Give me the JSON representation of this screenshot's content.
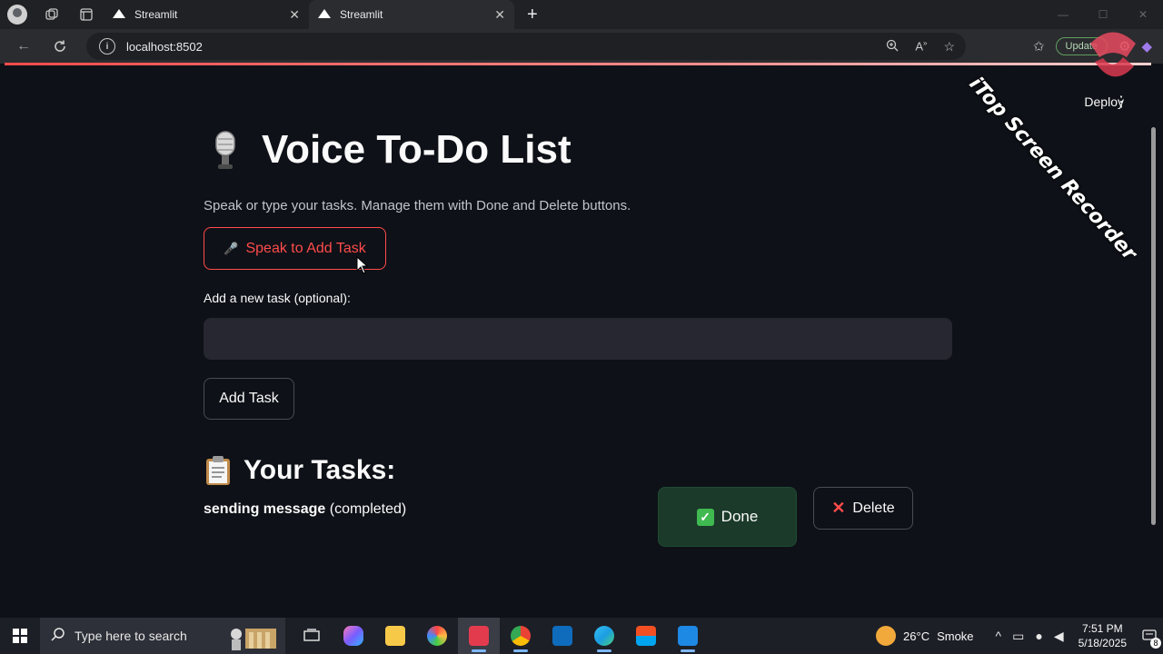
{
  "browser": {
    "tabs": [
      {
        "title": "Streamlit",
        "favicon": "streamlit-icon"
      },
      {
        "title": "Streamlit",
        "favicon": "streamlit-icon",
        "active": true
      }
    ],
    "url": "localhost:8502",
    "update_label": "Update"
  },
  "watermark": {
    "text": "iTop Screen Recorder"
  },
  "header": {
    "deploy_label": "Deploy"
  },
  "app": {
    "title": "Voice To-Do List",
    "title_icon": "microphone-emoji",
    "caption": "Speak or type your tasks. Manage them with Done and Delete buttons.",
    "speak_button": {
      "icon": "🎤",
      "label": "Speak to Add Task"
    },
    "input": {
      "label": "Add a new task (optional):",
      "value": "",
      "placeholder": ""
    },
    "add_button": {
      "label": "Add Task"
    },
    "tasks_heading": "Your Tasks:",
    "tasks_heading_icon": "clipboard-emoji",
    "tasks": [
      {
        "name": "sending message",
        "status": "(completed)",
        "done_label": "Done",
        "delete_label": "Delete"
      }
    ]
  },
  "taskbar": {
    "search_placeholder": "Type here to search",
    "weather": {
      "temp": "26°C",
      "condition": "Smoke"
    },
    "time": "7:51 PM",
    "date": "5/18/2025",
    "notification_count": "8"
  },
  "colors": {
    "accent": "#ff4b4b",
    "background": "#0e1117",
    "input_bg": "#262730",
    "done_bg": "#1b3a2a"
  }
}
